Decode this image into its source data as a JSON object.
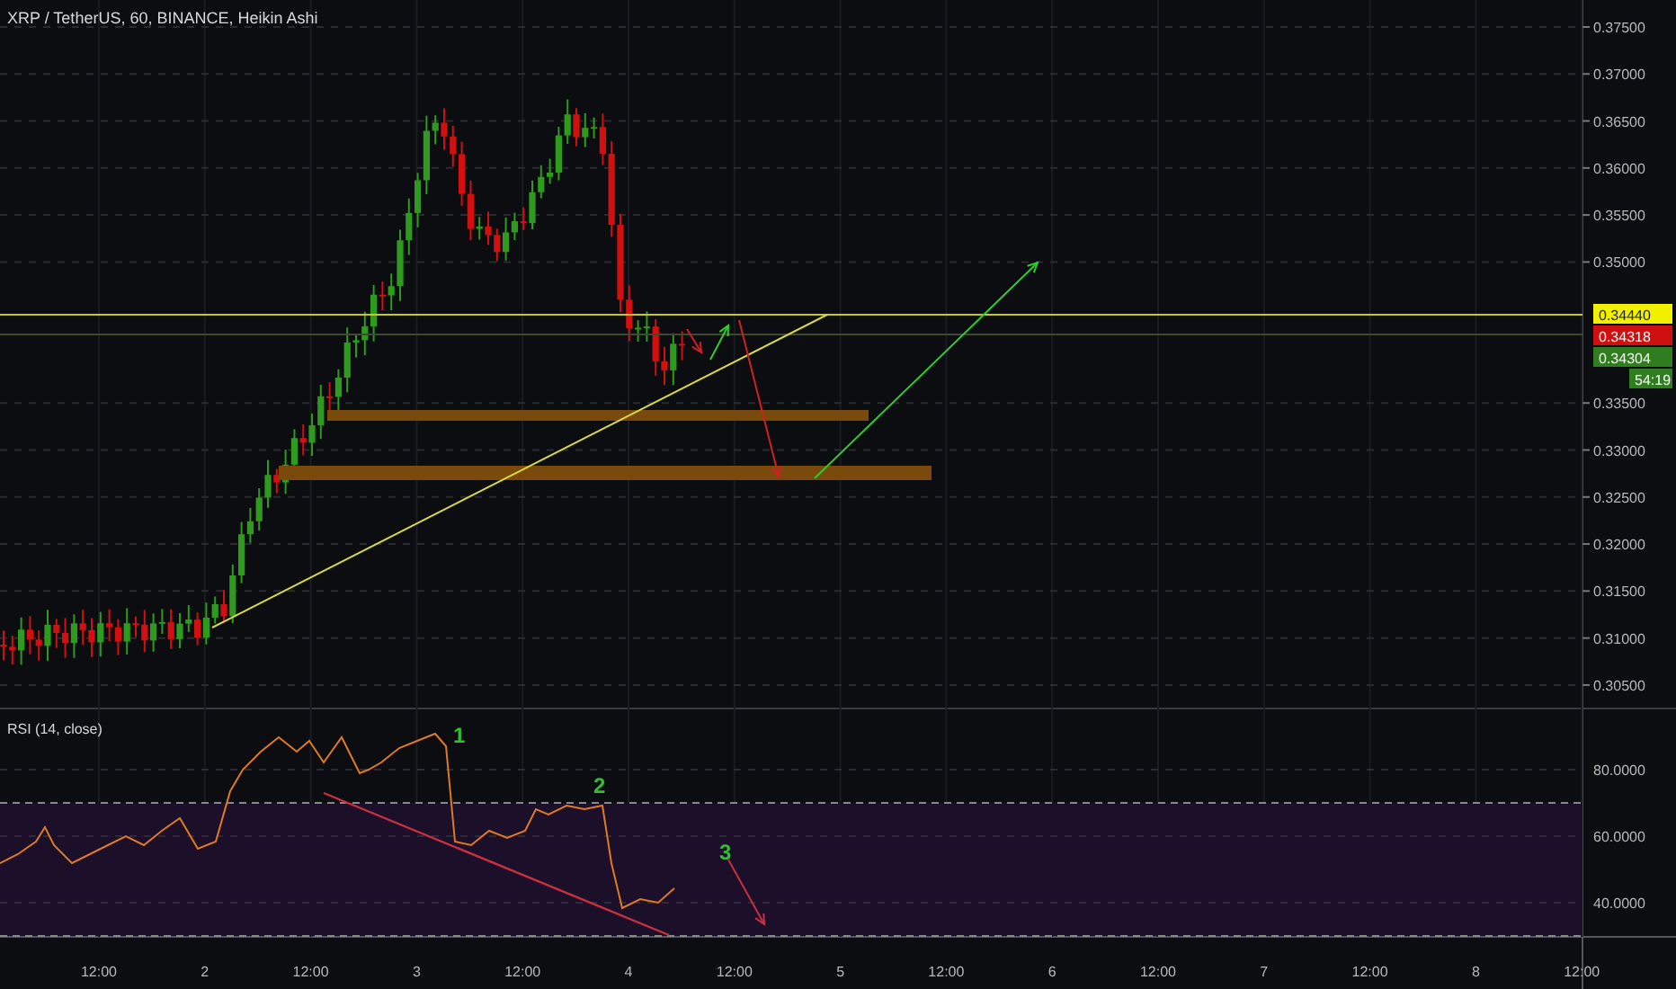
{
  "chart": {
    "title": "XRP / TetherUS, 60, BINANCE, Heikin Ashi",
    "price_axis": [
      "0.37500",
      "0.37000",
      "0.36500",
      "0.36000",
      "0.35500",
      "0.35000",
      "0.33500",
      "0.33000",
      "0.32500",
      "0.32000",
      "0.31500",
      "0.31000",
      "0.30500"
    ],
    "price_tags": [
      {
        "text": "0.34440",
        "color": "#f0f000"
      },
      {
        "text": "0.34318",
        "color": "#d01010"
      },
      {
        "text": "0.34304",
        "color": "#2f7d1f"
      },
      {
        "text": "54:19",
        "color": "#2f7d1f"
      }
    ]
  },
  "rsi": {
    "title": "RSI (14, close)",
    "axis": [
      "80.0000",
      "60.0000",
      "40.0000"
    ],
    "annotations": [
      "1",
      "2",
      "3"
    ]
  },
  "time_axis": [
    "12:00",
    "2",
    "12:00",
    "3",
    "12:00",
    "4",
    "12:00",
    "5",
    "12:00",
    "6",
    "12:00",
    "7",
    "12:00",
    "8",
    "12:00"
  ]
}
